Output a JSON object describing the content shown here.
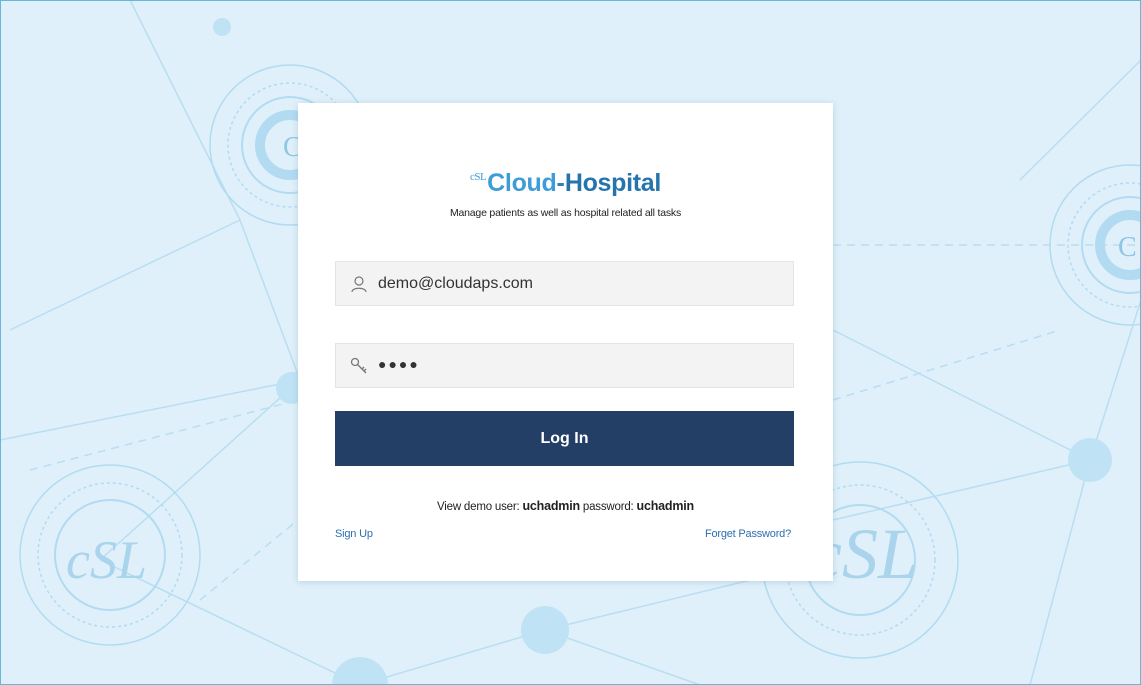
{
  "brand": {
    "logo_mark": "cSL",
    "name_part1": "Cloud",
    "name_separator": "-",
    "name_part2": "Hospital",
    "tagline": "Manage patients as well as hospital related all tasks"
  },
  "login_form": {
    "email_value": "demo@cloudaps.com",
    "password_masked": "●●●●",
    "login_button": "Log In",
    "demo_prefix": "View demo  user:",
    "demo_user": "uchadmin",
    "demo_password_label": "password:",
    "demo_password": "uchadmin",
    "signup_link": "Sign Up",
    "forget_link": "Forget Password?"
  },
  "background": {
    "watermark_text": "cSL"
  },
  "icons": {
    "email": "user-icon",
    "password": "key-icon"
  },
  "colors": {
    "background": "#dff0fa",
    "brand_light": "#3e9cd6",
    "brand_dark": "#2574ac",
    "button": "#243f66",
    "link": "#2e6fb0"
  }
}
